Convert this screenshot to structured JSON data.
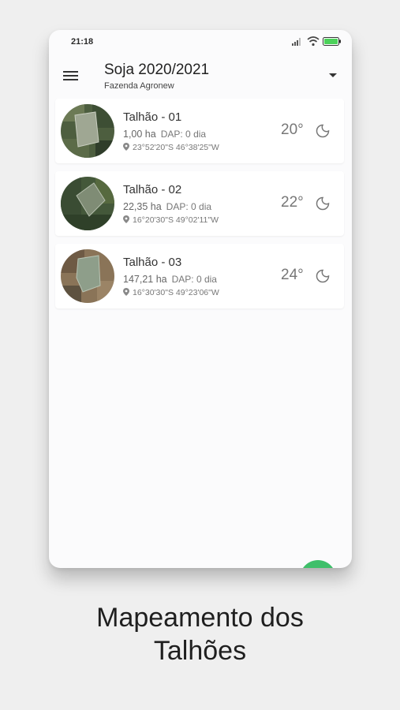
{
  "status_bar": {
    "time": "21:18",
    "icons": [
      "signal-icon",
      "wifi-icon",
      "battery-icon"
    ]
  },
  "header": {
    "menu_icon": "menu-icon",
    "title": "Soja 2020/2021",
    "subtitle": "Fazenda Agronew",
    "dropdown_icon": "caret-down-icon"
  },
  "fields": [
    {
      "name": "Talhão - 01",
      "area": "1,00 ha",
      "dap": "DAP: 0 dia",
      "coords": "23°52'20\"S 46°38'25\"W",
      "temp": "20°",
      "weather_icon": "moon-icon"
    },
    {
      "name": "Talhão - 02",
      "area": "22,35 ha",
      "dap": "DAP: 0 dia",
      "coords": "16°20'30\"S 49°02'11\"W",
      "temp": "22°",
      "weather_icon": "moon-icon"
    },
    {
      "name": "Talhão - 03",
      "area": "147,21 ha",
      "dap": "DAP: 0 dia",
      "coords": "16°30'30\"S 49°23'06\"W",
      "temp": "24°",
      "weather_icon": "moon-icon"
    }
  ],
  "fab": {
    "icon": "add-icon"
  },
  "caption": {
    "line1": "Mapeamento dos",
    "line2": "Talhões"
  },
  "colors": {
    "background": "#efefef",
    "screen": "#fbfbfc",
    "fab": "#3fbf6a",
    "battery": "#4cd15a"
  }
}
